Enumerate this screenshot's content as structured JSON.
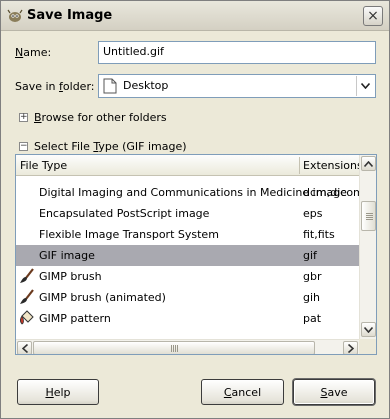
{
  "window": {
    "title": "Save Image",
    "icon": "gimp-icon",
    "close_glyph": "×"
  },
  "name_field": {
    "label_prefix": "",
    "label_mnemonic": "N",
    "label_rest": "ame:",
    "value": "Untitled.gif"
  },
  "folder_field": {
    "label_prefix": "Save in ",
    "label_mnemonic": "f",
    "label_rest": "older:",
    "value": "Desktop",
    "icon": "folder-icon"
  },
  "browse": {
    "expander": "+",
    "label_mnemonic": "B",
    "label_rest": "rowse for other folders"
  },
  "file_type": {
    "expander": "−",
    "label_prefix": "Select File ",
    "label_mnemonic": "T",
    "label_rest": "ype (GIF image)"
  },
  "table": {
    "columns": [
      "File Type",
      "Extensions"
    ],
    "rows": [
      {
        "name": "Digital Imaging and Communications in Medicine image",
        "ext": "dcm,dicom",
        "icon": ""
      },
      {
        "name": "Encapsulated PostScript image",
        "ext": "eps",
        "icon": ""
      },
      {
        "name": "Flexible Image Transport System",
        "ext": "fit,fits",
        "icon": ""
      },
      {
        "name": "GIF image",
        "ext": "gif",
        "icon": "",
        "selected": true
      },
      {
        "name": "GIMP brush",
        "ext": "gbr",
        "icon": "brush-icon"
      },
      {
        "name": "GIMP brush (animated)",
        "ext": "gih",
        "icon": "brush-icon"
      },
      {
        "name": "GIMP pattern",
        "ext": "pat",
        "icon": "pattern-icon"
      }
    ]
  },
  "buttons": {
    "help_mnemonic": "H",
    "help_rest": "elp",
    "cancel_mnemonic": "C",
    "cancel_rest": "ancel",
    "save_mnemonic": "S",
    "save_rest": "ave"
  },
  "colors": {
    "selection": "#a9a9b0",
    "dialog_bg": "#ece9d8",
    "field_border": "#7f9db9"
  }
}
